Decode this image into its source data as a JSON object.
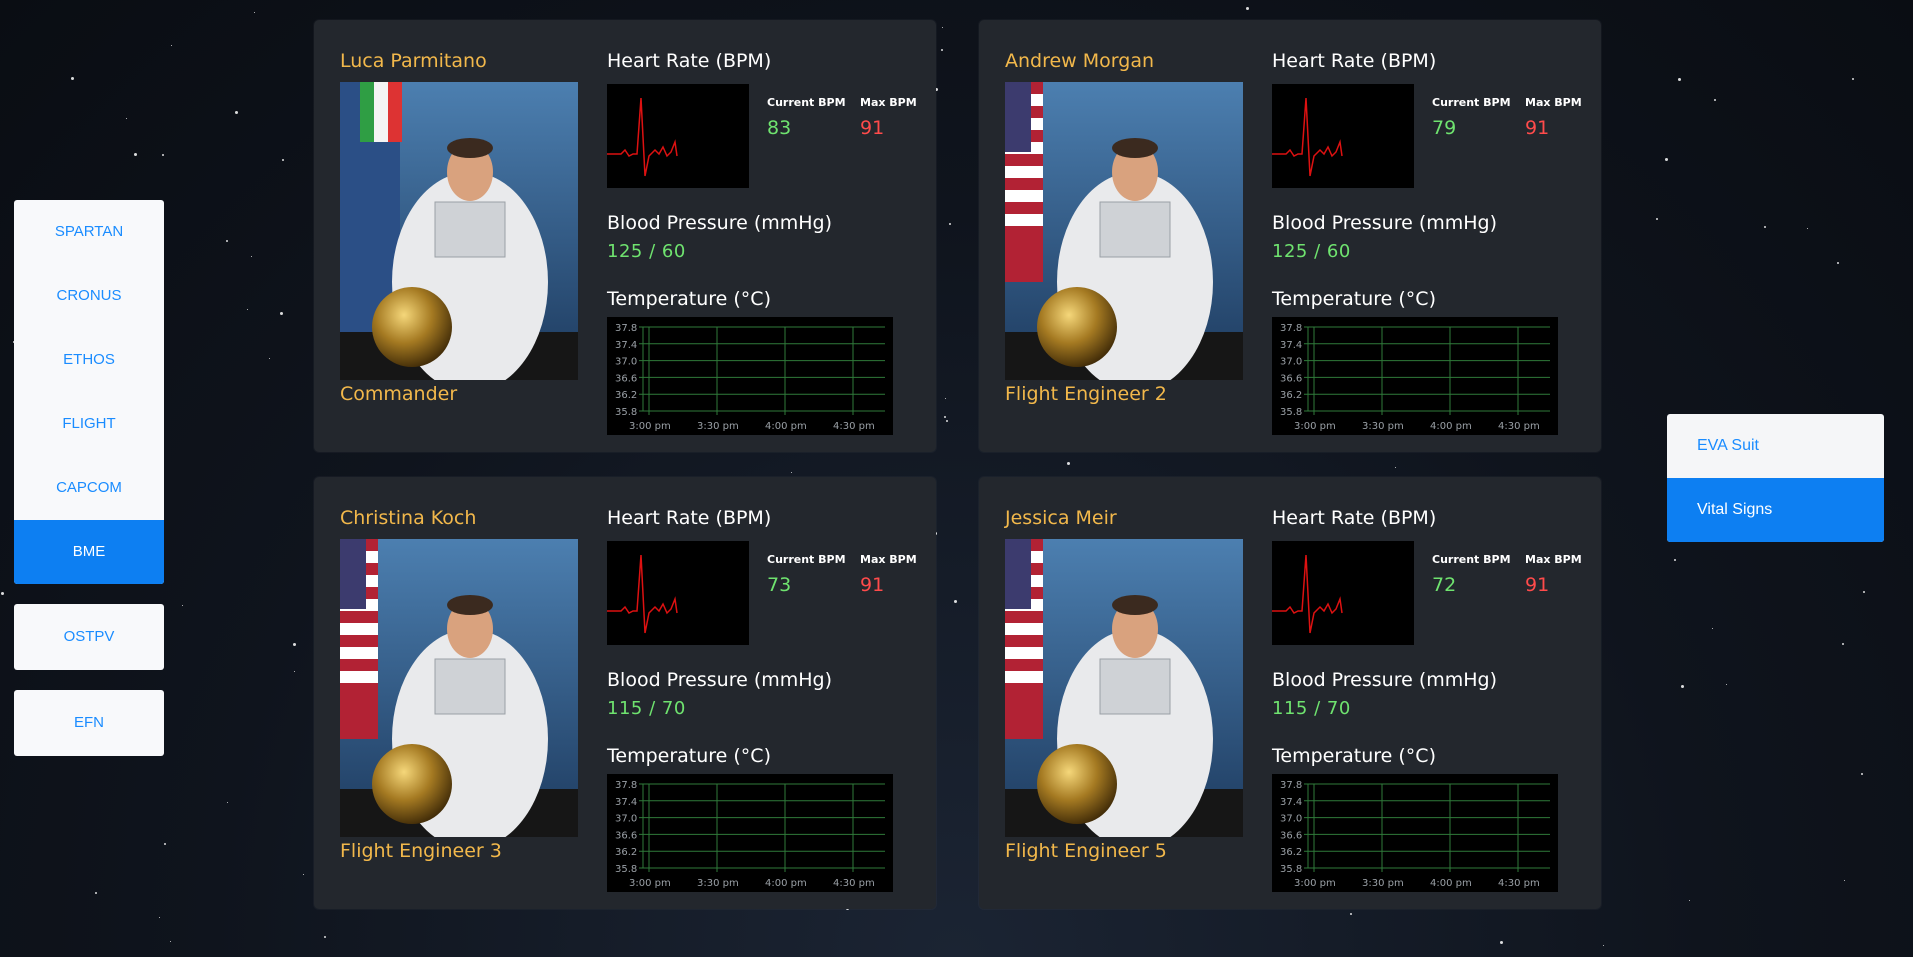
{
  "left_nav": {
    "group1": [
      "SPARTAN",
      "CRONUS",
      "ETHOS",
      "FLIGHT",
      "CAPCOM",
      "BME"
    ],
    "active": "BME",
    "ostpv": "OSTPV",
    "efn": "EFN"
  },
  "right_nav": {
    "items": [
      "EVA Suit",
      "Vital Signs"
    ],
    "active": "Vital Signs"
  },
  "labels": {
    "heart_rate": "Heart Rate (BPM)",
    "current_bpm": "Current BPM",
    "max_bpm": "Max BPM",
    "blood_pressure": "Blood Pressure (mmHg)",
    "temperature": "Temperature (°C)"
  },
  "temp_axis": {
    "y_ticks": [
      "37.8",
      "37.4",
      "37.0",
      "36.6",
      "36.2",
      "35.8"
    ],
    "x_ticks": [
      "3:00 pm",
      "3:30 pm",
      "4:00 pm",
      "4:30 pm"
    ]
  },
  "crew": [
    {
      "name": "Luca Parmitano",
      "role": "Commander",
      "current_bpm": "83",
      "max_bpm": "91",
      "bp": "125 / 60",
      "flag": "italy"
    },
    {
      "name": "Andrew Morgan",
      "role": "Flight Engineer 2",
      "current_bpm": "79",
      "max_bpm": "91",
      "bp": "125 / 60",
      "flag": "usa"
    },
    {
      "name": "Christina Koch",
      "role": "Flight Engineer 3",
      "current_bpm": "73",
      "max_bpm": "91",
      "bp": "115 / 70",
      "flag": "usa"
    },
    {
      "name": "Jessica Meir",
      "role": "Flight Engineer 5",
      "current_bpm": "72",
      "max_bpm": "91",
      "bp": "115 / 70",
      "flag": "usa"
    }
  ],
  "colors": {
    "accent": "#0d7ff2",
    "name": "#f2b84b",
    "good": "#6fe36f",
    "alert": "#ff4b4b"
  }
}
